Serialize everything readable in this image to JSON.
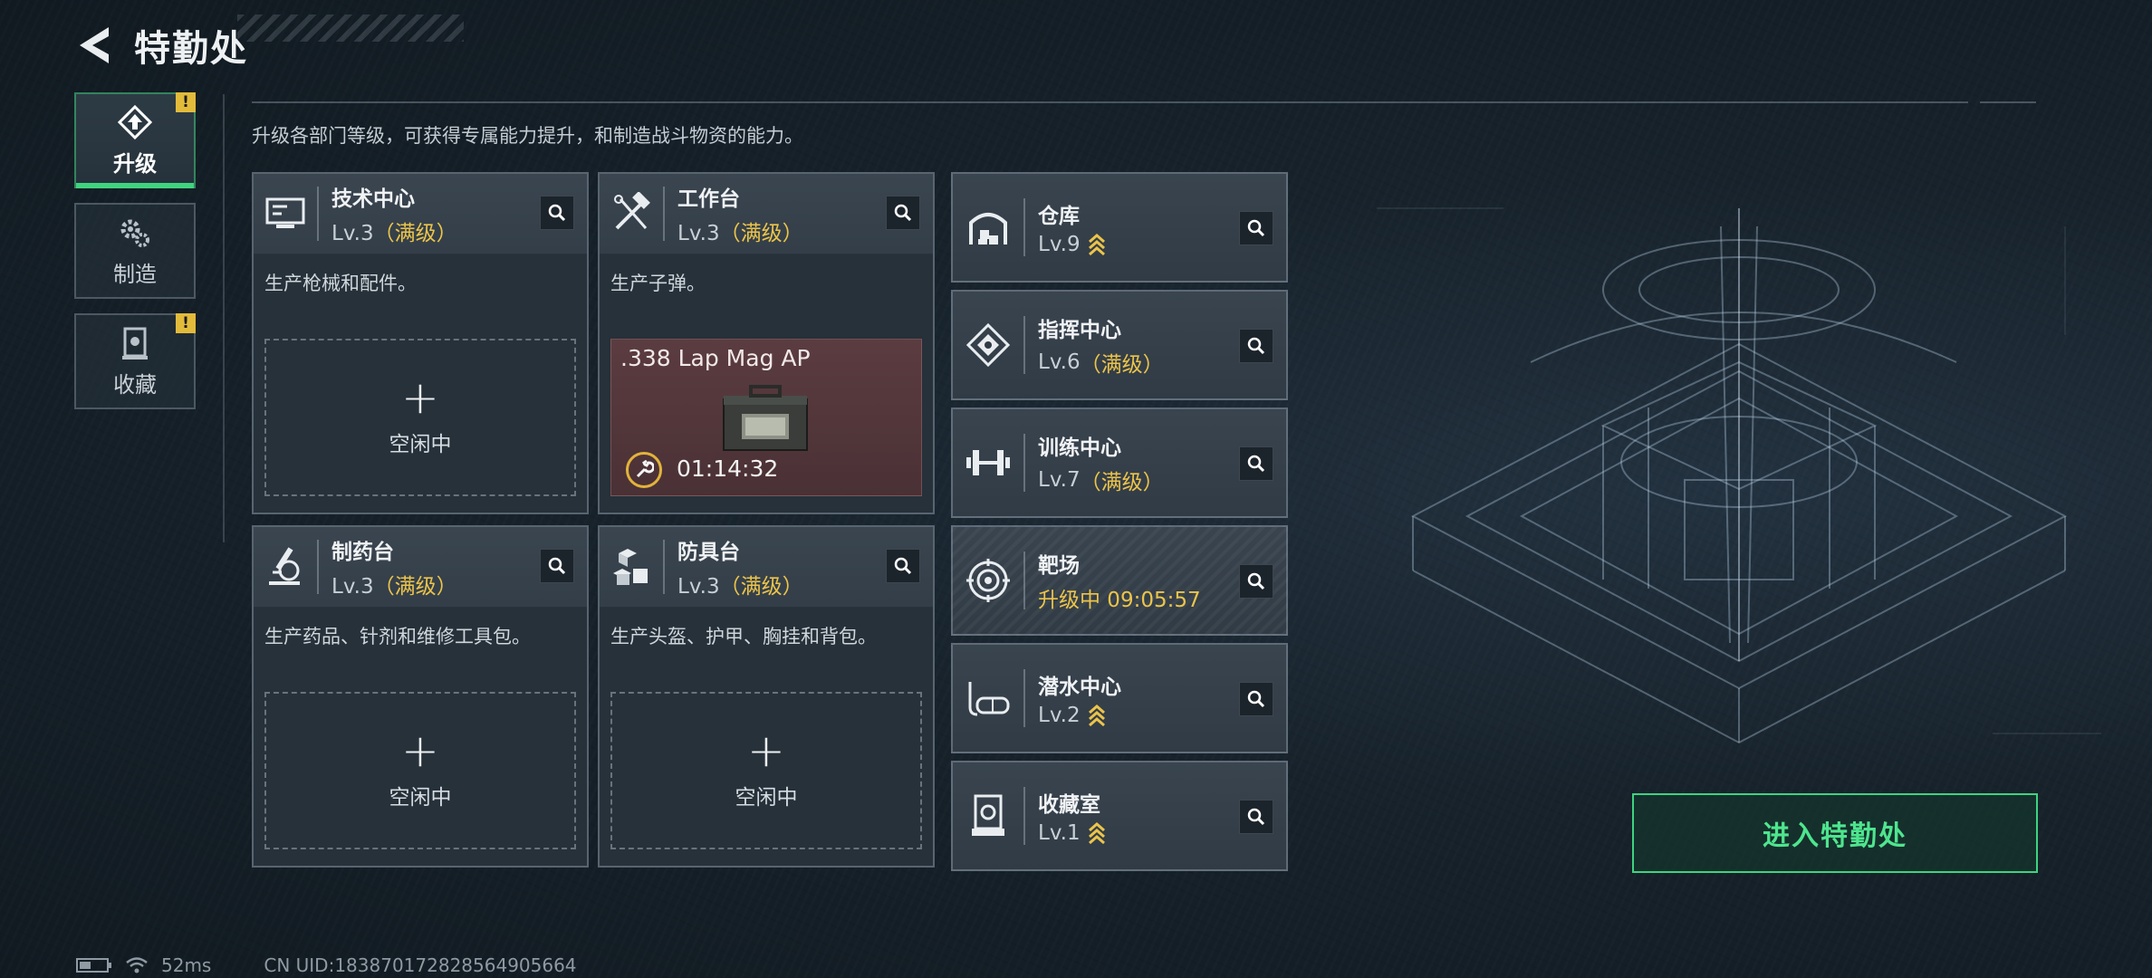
{
  "header": {
    "title": "特勤处"
  },
  "sidebar": {
    "tabs": [
      {
        "label": "升级",
        "active": true,
        "alert": "!"
      },
      {
        "label": "制造",
        "active": false,
        "alert": ""
      },
      {
        "label": "收藏",
        "active": false,
        "alert": "!"
      }
    ]
  },
  "description": "升级各部门等级，可获得专属能力提升，和制造战斗物资的能力。",
  "cards": [
    {
      "name": "技术中心",
      "level": "Lv.3",
      "max_tag": "（满级）",
      "desc": "生产枪械和配件。",
      "slot": {
        "state": "idle",
        "plus": "+",
        "label": "空闲中"
      }
    },
    {
      "name": "工作台",
      "level": "Lv.3",
      "max_tag": "（满级）",
      "desc": "生产子弹。",
      "slot": {
        "state": "producing",
        "item": ".338 Lap Mag AP",
        "timer": "01:14:32"
      }
    },
    {
      "name": "制药台",
      "level": "Lv.3",
      "max_tag": "（满级）",
      "desc": "生产药品、针剂和维修工具包。",
      "slot": {
        "state": "idle",
        "plus": "+",
        "label": "空闲中"
      }
    },
    {
      "name": "防具台",
      "level": "Lv.3",
      "max_tag": "（满级）",
      "desc": "生产头盔、护甲、胸挂和背包。",
      "slot": {
        "state": "idle",
        "plus": "+",
        "label": "空闲中"
      }
    }
  ],
  "facilities": [
    {
      "name": "仓库",
      "level": "Lv.9",
      "max_tag": "",
      "status": "",
      "upgradable": true
    },
    {
      "name": "指挥中心",
      "level": "Lv.6",
      "max_tag": "（满级）",
      "status": "",
      "upgradable": false
    },
    {
      "name": "训练中心",
      "level": "Lv.7",
      "max_tag": "（满级）",
      "status": "",
      "upgradable": false
    },
    {
      "name": "靶场",
      "level": "",
      "max_tag": "",
      "status": "升级中 09:05:57",
      "upgradable": false
    },
    {
      "name": "潜水中心",
      "level": "Lv.2",
      "max_tag": "",
      "status": "",
      "upgradable": true
    },
    {
      "name": "收藏室",
      "level": "Lv.1",
      "max_tag": "",
      "status": "",
      "upgradable": true
    }
  ],
  "enter_button": "进入特勤处",
  "status_bar": {
    "ping": "52ms",
    "uid": "CN UID:18387017282856490​5664"
  },
  "colors": {
    "accent_green": "#3fd37f",
    "gold": "#ecc44a",
    "alert_yellow": "#e2bb3b",
    "producing_bg": "#5b3c40"
  },
  "icons": {
    "back": "chevron-left-icon",
    "search": "search-icon",
    "upgrade": "upgrade-icon",
    "craft": "gears-icon",
    "collection": "trophy-icon",
    "tech_center": "computer-icon",
    "workbench": "tools-icon",
    "pharmacy": "microscope-icon",
    "armor": "cubes-icon",
    "storage": "warehouse-icon",
    "command": "emblem-icon",
    "training": "dumbbell-icon",
    "range": "target-icon",
    "dive": "diving-mask-icon",
    "collection_room": "display-case-icon",
    "wrench": "wrench-icon"
  }
}
